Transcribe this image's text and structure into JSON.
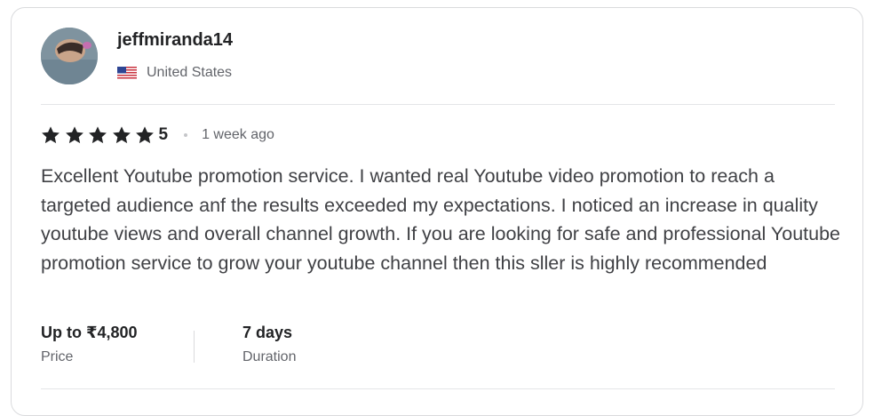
{
  "reviewer": {
    "username": "jeffmiranda14",
    "country": "United States",
    "avatar_icon": "avatar-photo",
    "flag_icon": "us-flag-icon"
  },
  "rating": {
    "value": "5",
    "stars": 5,
    "time_ago": "1 week ago"
  },
  "review": {
    "text": "Excellent Youtube promotion service. I wanted real Youtube video promotion to reach a targeted audience anf the results exceeded my expectations. I noticed an increase in quality youtube views and overall channel growth. If you are looking for safe and professional Youtube promotion service to grow your youtube channel then this sller is highly recommended"
  },
  "details": {
    "price_value": "Up to ₹4,800",
    "price_label": "Price",
    "duration_value": "7 days",
    "duration_label": "Duration"
  },
  "colors": {
    "star": "#222325",
    "text": "#404145",
    "muted": "#62646a",
    "border": "#dadbdd"
  }
}
